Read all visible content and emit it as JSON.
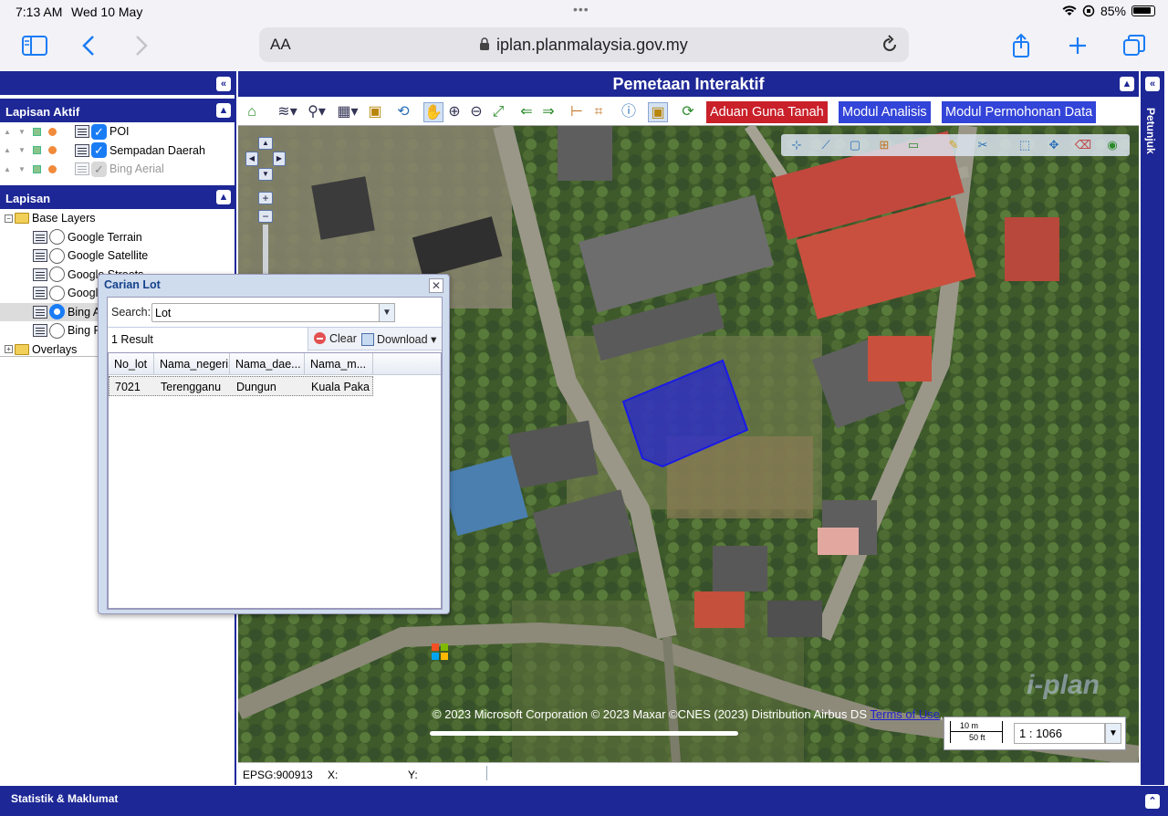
{
  "status": {
    "time": "7:13 AM",
    "date": "Wed 10 May",
    "battery": "85%"
  },
  "browser": {
    "aa": "AA",
    "url": "iplan.planmalaysia.gov.my"
  },
  "left": {
    "active_title": "Lapisan Aktif",
    "active_layers": [
      {
        "label": "POI",
        "checked": true
      },
      {
        "label": "Sempadan Daerah",
        "checked": true
      },
      {
        "label": "Bing Aerial",
        "checked": false
      }
    ],
    "layers_title": "Lapisan",
    "base_layers": "Base Layers",
    "bases": [
      "Google Terrain",
      "Google Satellite",
      "Google Streets",
      "Google",
      "Bing A",
      "Bing R"
    ],
    "overlays": "Overlays"
  },
  "map": {
    "title": "Pemetaan Interaktif",
    "btn_aduan": "Aduan Guna Tanah",
    "btn_analisis": "Modul Analisis",
    "btn_permohonan": "Modul Permohonan Data",
    "attribution": "© 2023 Microsoft Corporation © 2023 Maxar ©CNES (2023) Distribution Airbus DS",
    "terms": "Terms of Use",
    "scale_m": "10 m",
    "scale_ft": "50 ft",
    "scale_ratio": "1 : 1066",
    "epsg": "EPSG:900913",
    "x": "X:",
    "y": "Y:",
    "logo": "i-plan"
  },
  "right_tab": "Petunjuk",
  "bottom": "Statistik & Maklumat",
  "dialog": {
    "title": "Carian Lot",
    "search_label": "Search:",
    "search_value": "Lot",
    "result_count": "1 Result",
    "clear": "Clear",
    "download": "Download",
    "columns": [
      "No_lot",
      "Nama_negeri",
      "Nama_dae...",
      "Nama_m..."
    ],
    "rows": [
      [
        "7021",
        "Terengganu",
        "Dungun",
        "Kuala Paka"
      ]
    ]
  }
}
